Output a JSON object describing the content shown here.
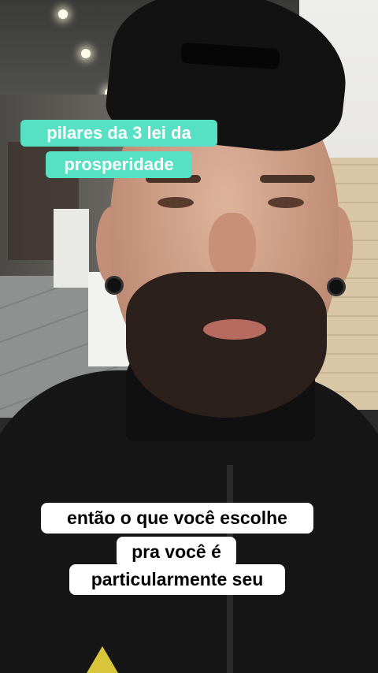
{
  "captions": {
    "top": {
      "line1": "pilares da 3 lei da",
      "line2": "prosperidade",
      "background": "#56e0c4",
      "text_color": "#ffffff"
    },
    "bottom": {
      "line1": "então o que você escolhe",
      "line2": "pra você é",
      "line3": "particularmente seu",
      "background": "#ffffff",
      "text_color": "#000000"
    }
  }
}
